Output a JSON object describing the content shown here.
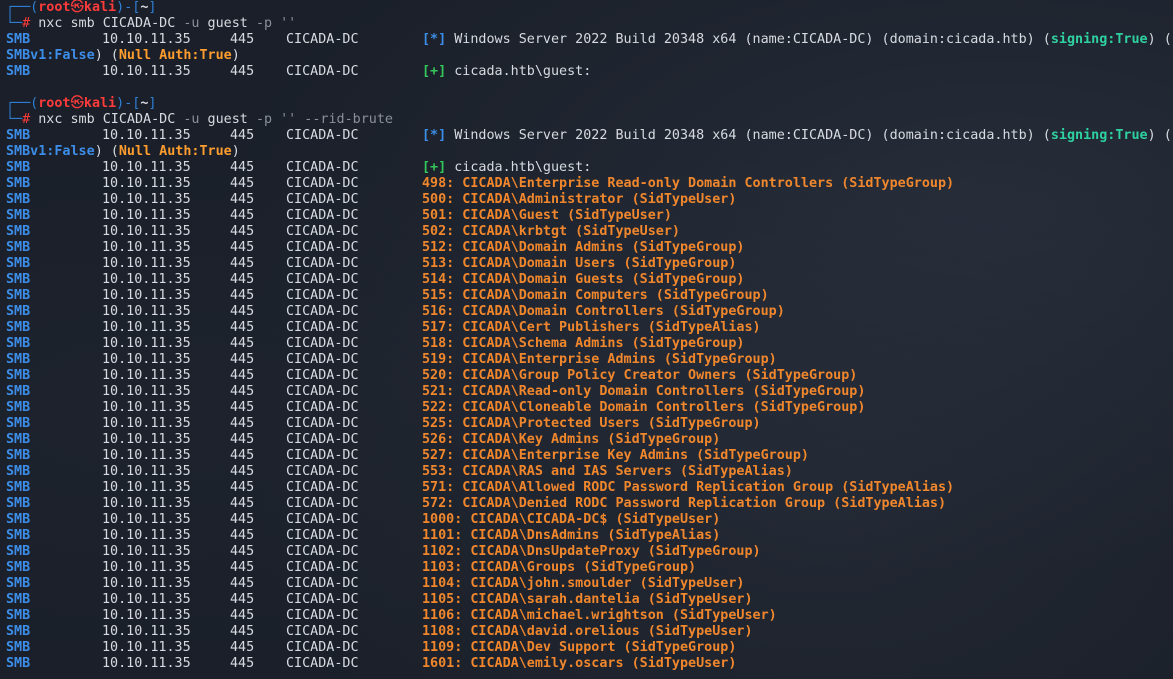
{
  "prompt": {
    "frame_top_left": "┌──(",
    "user": "root",
    "at": "㉿",
    "host": "kali",
    "mid": ")-[",
    "dir": "~",
    "close": "]",
    "frame_bottom": "└─",
    "hash": "#"
  },
  "commands": [
    {
      "cmd": "nxc",
      "args": " smb CICADA-DC ",
      "flags": "-u",
      "arg2": " guest ",
      "flag2": "-p",
      "rest": " ''"
    },
    {
      "cmd": "nxc",
      "args": " smb CICADA-DC ",
      "flags": "-u",
      "arg2": " guest ",
      "flag2": "-p",
      "rest": " '' --rid-brute"
    }
  ],
  "protocol": "SMB",
  "ip": "10.10.11.35",
  "port": "445",
  "host": "CICADA-DC",
  "banner": {
    "star": "[*]",
    "text": " Windows Server 2022 Build 20348 x64 (name:CICADA-DC) (domain:cicada.htb) (",
    "signing": "signing:True",
    "tail": ") (",
    "smbv1": "SMBv1:False",
    "mid": ") (",
    "null_auth": "Null Auth:True",
    "end": ")"
  },
  "auth": {
    "plus": "[+]",
    "text": " cicada.htb\\guest:"
  },
  "rid_entries": [
    "498: CICADA\\Enterprise Read-only Domain Controllers (SidTypeGroup)",
    "500: CICADA\\Administrator (SidTypeUser)",
    "501: CICADA\\Guest (SidTypeUser)",
    "502: CICADA\\krbtgt (SidTypeUser)",
    "512: CICADA\\Domain Admins (SidTypeGroup)",
    "513: CICADA\\Domain Users (SidTypeGroup)",
    "514: CICADA\\Domain Guests (SidTypeGroup)",
    "515: CICADA\\Domain Computers (SidTypeGroup)",
    "516: CICADA\\Domain Controllers (SidTypeGroup)",
    "517: CICADA\\Cert Publishers (SidTypeAlias)",
    "518: CICADA\\Schema Admins (SidTypeGroup)",
    "519: CICADA\\Enterprise Admins (SidTypeGroup)",
    "520: CICADA\\Group Policy Creator Owners (SidTypeGroup)",
    "521: CICADA\\Read-only Domain Controllers (SidTypeGroup)",
    "522: CICADA\\Cloneable Domain Controllers (SidTypeGroup)",
    "525: CICADA\\Protected Users (SidTypeGroup)",
    "526: CICADA\\Key Admins (SidTypeGroup)",
    "527: CICADA\\Enterprise Key Admins (SidTypeGroup)",
    "553: CICADA\\RAS and IAS Servers (SidTypeAlias)",
    "571: CICADA\\Allowed RODC Password Replication Group (SidTypeAlias)",
    "572: CICADA\\Denied RODC Password Replication Group (SidTypeAlias)",
    "1000: CICADA\\CICADA-DC$ (SidTypeUser)",
    "1101: CICADA\\DnsAdmins (SidTypeAlias)",
    "1102: CICADA\\DnsUpdateProxy (SidTypeGroup)",
    "1103: CICADA\\Groups (SidTypeGroup)",
    "1104: CICADA\\john.smoulder (SidTypeUser)",
    "1105: CICADA\\sarah.dantelia (SidTypeUser)",
    "1106: CICADA\\michael.wrightson (SidTypeUser)",
    "1108: CICADA\\david.orelious (SidTypeUser)",
    "1109: CICADA\\Dev Support (SidTypeGroup)",
    "1601: CICADA\\emily.oscars (SidTypeUser)"
  ],
  "colors": {
    "background": "#1a1f29",
    "smb": "#3d8ee8",
    "rid_text": "#f0872d",
    "prompt_user": "#ff3b3b",
    "signing": "#2fd1a0",
    "null_auth": "#ff9d2e",
    "plus": "#34c759"
  }
}
